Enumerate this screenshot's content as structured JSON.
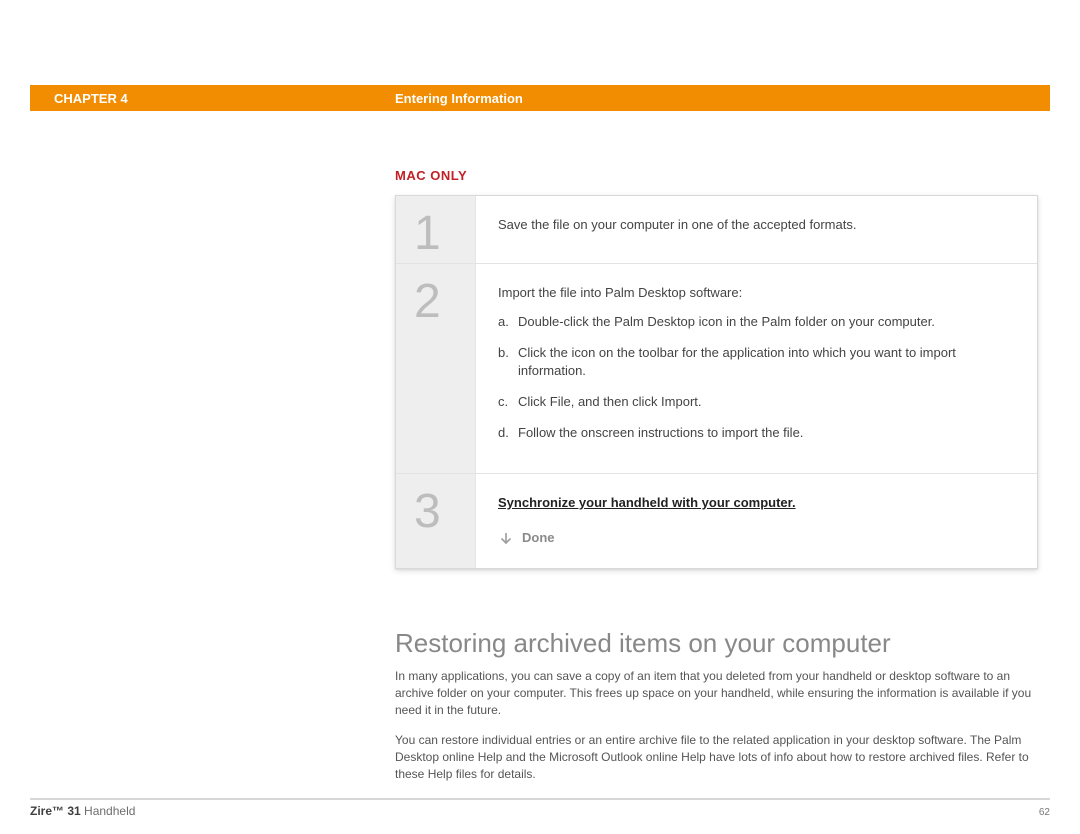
{
  "header": {
    "chapter_label": "CHAPTER 4",
    "section_title": "Entering Information"
  },
  "mac_only_label": "MAC ONLY",
  "steps": {
    "s1": {
      "num": "1",
      "text": "Save the file on your computer in one of the accepted formats."
    },
    "s2": {
      "num": "2",
      "intro": "Import the file into Palm Desktop software:",
      "a_label": "a.",
      "a_text": "Double-click the Palm Desktop icon in the Palm folder on your computer.",
      "b_label": "b.",
      "b_text": "Click the icon on the toolbar for the application into which you want to import information.",
      "c_label": "c.",
      "c_text": "Click File, and then click Import.",
      "d_label": "d.",
      "d_text": "Follow the onscreen instructions to import the file."
    },
    "s3": {
      "num": "3",
      "sync_link_text": "Synchronize your handheld with your computer.",
      "done_label": "Done"
    }
  },
  "section": {
    "heading": "Restoring archived items on your computer",
    "para1": "In many applications, you can save a copy of an item that you deleted from your handheld or desktop software to an archive folder on your computer. This frees up space on your handheld, while ensuring the information is available if you need it in the future.",
    "para2": "You can restore individual entries or an entire archive file to the related application in your desktop software. The Palm Desktop online Help and the Microsoft Outlook online Help have lots of info about how to restore archived files. Refer to these Help files for details."
  },
  "footer": {
    "product_bold": "Zire™ 31",
    "product_rest": " Handheld",
    "page_number": "62"
  }
}
